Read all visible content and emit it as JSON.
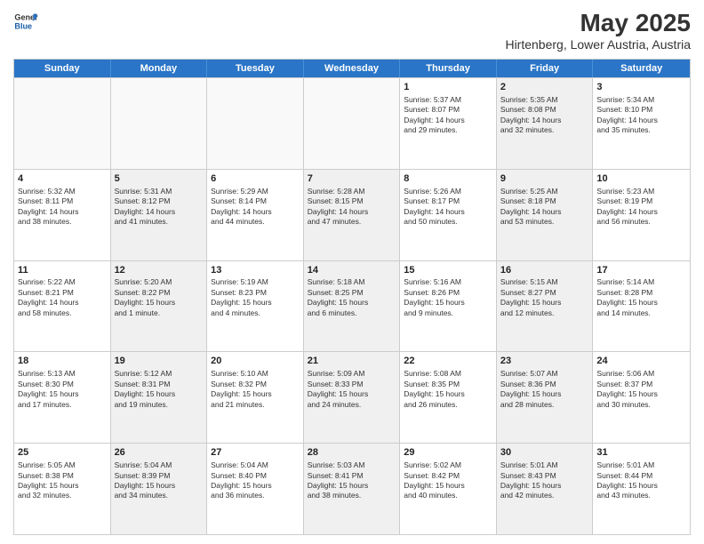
{
  "logo": {
    "line1": "General",
    "line2": "Blue"
  },
  "title": "May 2025",
  "subtitle": "Hirtenberg, Lower Austria, Austria",
  "header_days": [
    "Sunday",
    "Monday",
    "Tuesday",
    "Wednesday",
    "Thursday",
    "Friday",
    "Saturday"
  ],
  "weeks": [
    [
      {
        "day": "",
        "info": "",
        "empty": true
      },
      {
        "day": "",
        "info": "",
        "empty": true
      },
      {
        "day": "",
        "info": "",
        "empty": true
      },
      {
        "day": "",
        "info": "",
        "empty": true
      },
      {
        "day": "1",
        "info": "Sunrise: 5:37 AM\nSunset: 8:07 PM\nDaylight: 14 hours\nand 29 minutes.",
        "shaded": false
      },
      {
        "day": "2",
        "info": "Sunrise: 5:35 AM\nSunset: 8:08 PM\nDaylight: 14 hours\nand 32 minutes.",
        "shaded": true
      },
      {
        "day": "3",
        "info": "Sunrise: 5:34 AM\nSunset: 8:10 PM\nDaylight: 14 hours\nand 35 minutes.",
        "shaded": false
      }
    ],
    [
      {
        "day": "4",
        "info": "Sunrise: 5:32 AM\nSunset: 8:11 PM\nDaylight: 14 hours\nand 38 minutes.",
        "shaded": false
      },
      {
        "day": "5",
        "info": "Sunrise: 5:31 AM\nSunset: 8:12 PM\nDaylight: 14 hours\nand 41 minutes.",
        "shaded": true
      },
      {
        "day": "6",
        "info": "Sunrise: 5:29 AM\nSunset: 8:14 PM\nDaylight: 14 hours\nand 44 minutes.",
        "shaded": false
      },
      {
        "day": "7",
        "info": "Sunrise: 5:28 AM\nSunset: 8:15 PM\nDaylight: 14 hours\nand 47 minutes.",
        "shaded": true
      },
      {
        "day": "8",
        "info": "Sunrise: 5:26 AM\nSunset: 8:17 PM\nDaylight: 14 hours\nand 50 minutes.",
        "shaded": false
      },
      {
        "day": "9",
        "info": "Sunrise: 5:25 AM\nSunset: 8:18 PM\nDaylight: 14 hours\nand 53 minutes.",
        "shaded": true
      },
      {
        "day": "10",
        "info": "Sunrise: 5:23 AM\nSunset: 8:19 PM\nDaylight: 14 hours\nand 56 minutes.",
        "shaded": false
      }
    ],
    [
      {
        "day": "11",
        "info": "Sunrise: 5:22 AM\nSunset: 8:21 PM\nDaylight: 14 hours\nand 58 minutes.",
        "shaded": false
      },
      {
        "day": "12",
        "info": "Sunrise: 5:20 AM\nSunset: 8:22 PM\nDaylight: 15 hours\nand 1 minute.",
        "shaded": true
      },
      {
        "day": "13",
        "info": "Sunrise: 5:19 AM\nSunset: 8:23 PM\nDaylight: 15 hours\nand 4 minutes.",
        "shaded": false
      },
      {
        "day": "14",
        "info": "Sunrise: 5:18 AM\nSunset: 8:25 PM\nDaylight: 15 hours\nand 6 minutes.",
        "shaded": true
      },
      {
        "day": "15",
        "info": "Sunrise: 5:16 AM\nSunset: 8:26 PM\nDaylight: 15 hours\nand 9 minutes.",
        "shaded": false
      },
      {
        "day": "16",
        "info": "Sunrise: 5:15 AM\nSunset: 8:27 PM\nDaylight: 15 hours\nand 12 minutes.",
        "shaded": true
      },
      {
        "day": "17",
        "info": "Sunrise: 5:14 AM\nSunset: 8:28 PM\nDaylight: 15 hours\nand 14 minutes.",
        "shaded": false
      }
    ],
    [
      {
        "day": "18",
        "info": "Sunrise: 5:13 AM\nSunset: 8:30 PM\nDaylight: 15 hours\nand 17 minutes.",
        "shaded": false
      },
      {
        "day": "19",
        "info": "Sunrise: 5:12 AM\nSunset: 8:31 PM\nDaylight: 15 hours\nand 19 minutes.",
        "shaded": true
      },
      {
        "day": "20",
        "info": "Sunrise: 5:10 AM\nSunset: 8:32 PM\nDaylight: 15 hours\nand 21 minutes.",
        "shaded": false
      },
      {
        "day": "21",
        "info": "Sunrise: 5:09 AM\nSunset: 8:33 PM\nDaylight: 15 hours\nand 24 minutes.",
        "shaded": true
      },
      {
        "day": "22",
        "info": "Sunrise: 5:08 AM\nSunset: 8:35 PM\nDaylight: 15 hours\nand 26 minutes.",
        "shaded": false
      },
      {
        "day": "23",
        "info": "Sunrise: 5:07 AM\nSunset: 8:36 PM\nDaylight: 15 hours\nand 28 minutes.",
        "shaded": true
      },
      {
        "day": "24",
        "info": "Sunrise: 5:06 AM\nSunset: 8:37 PM\nDaylight: 15 hours\nand 30 minutes.",
        "shaded": false
      }
    ],
    [
      {
        "day": "25",
        "info": "Sunrise: 5:05 AM\nSunset: 8:38 PM\nDaylight: 15 hours\nand 32 minutes.",
        "shaded": false
      },
      {
        "day": "26",
        "info": "Sunrise: 5:04 AM\nSunset: 8:39 PM\nDaylight: 15 hours\nand 34 minutes.",
        "shaded": true
      },
      {
        "day": "27",
        "info": "Sunrise: 5:04 AM\nSunset: 8:40 PM\nDaylight: 15 hours\nand 36 minutes.",
        "shaded": false
      },
      {
        "day": "28",
        "info": "Sunrise: 5:03 AM\nSunset: 8:41 PM\nDaylight: 15 hours\nand 38 minutes.",
        "shaded": true
      },
      {
        "day": "29",
        "info": "Sunrise: 5:02 AM\nSunset: 8:42 PM\nDaylight: 15 hours\nand 40 minutes.",
        "shaded": false
      },
      {
        "day": "30",
        "info": "Sunrise: 5:01 AM\nSunset: 8:43 PM\nDaylight: 15 hours\nand 42 minutes.",
        "shaded": true
      },
      {
        "day": "31",
        "info": "Sunrise: 5:01 AM\nSunset: 8:44 PM\nDaylight: 15 hours\nand 43 minutes.",
        "shaded": false
      }
    ]
  ]
}
